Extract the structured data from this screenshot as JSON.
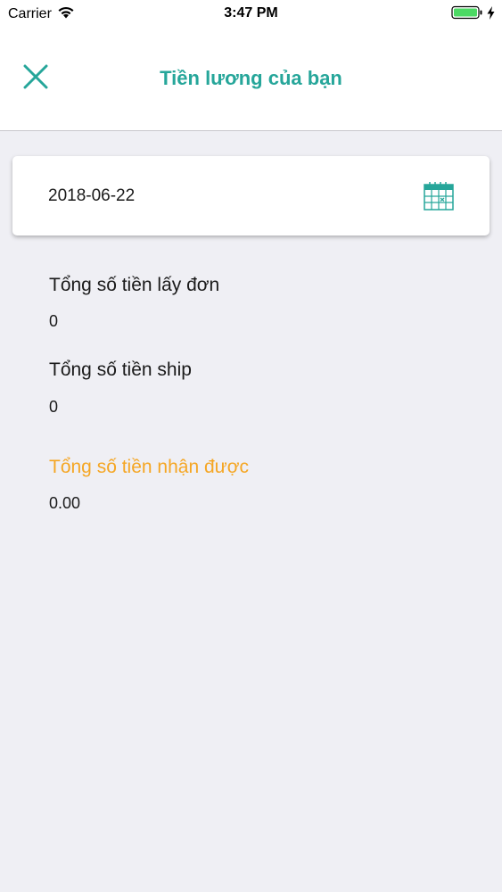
{
  "status_bar": {
    "carrier": "Carrier",
    "time": "3:47 PM",
    "battery_color": "#4cd964"
  },
  "nav": {
    "title": "Tiền lương của bạn",
    "accent_color": "#26a69a",
    "close_icon": "close-icon"
  },
  "date_picker": {
    "value": "2018-06-22",
    "icon": "calendar-icon"
  },
  "summary": {
    "order_total_label": "Tổng số tiền lấy đơn",
    "order_total_value": "0",
    "ship_total_label": "Tổng số tiền ship",
    "ship_total_value": "0",
    "received_total_label": "Tổng số tiền nhận được",
    "received_total_value": "0.00",
    "highlight_color": "#f5a623"
  }
}
